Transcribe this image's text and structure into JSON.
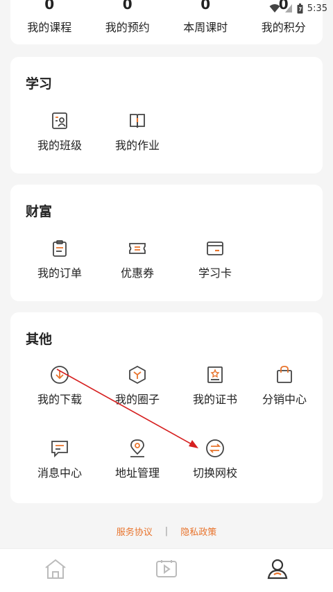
{
  "status_bar": {
    "time": "5:35",
    "icons": [
      "wifi-icon",
      "signal-icon",
      "battery-icon"
    ]
  },
  "stats": [
    {
      "value": "0",
      "label": "我的课程"
    },
    {
      "value": "0",
      "label": "我的预约"
    },
    {
      "value": "0",
      "label": "本周课时"
    },
    {
      "value": "0",
      "label": "我的积分"
    }
  ],
  "study": {
    "title": "学习",
    "items": [
      {
        "label": "我的班级",
        "icon": "class-icon"
      },
      {
        "label": "我的作业",
        "icon": "homework-icon"
      }
    ]
  },
  "wealth": {
    "title": "财富",
    "items": [
      {
        "label": "我的订单",
        "icon": "order-icon"
      },
      {
        "label": "优惠券",
        "icon": "coupon-icon"
      },
      {
        "label": "学习卡",
        "icon": "card-icon"
      }
    ]
  },
  "other": {
    "title": "其他",
    "items": [
      {
        "label": "我的下载",
        "icon": "download-icon"
      },
      {
        "label": "我的圈子",
        "icon": "circle-icon"
      },
      {
        "label": "我的证书",
        "icon": "certificate-icon"
      },
      {
        "label": "分销中心",
        "icon": "bag-icon"
      },
      {
        "label": "消息中心",
        "icon": "message-icon"
      },
      {
        "label": "地址管理",
        "icon": "location-icon"
      },
      {
        "label": "切换网校",
        "icon": "switch-icon"
      }
    ]
  },
  "footer": {
    "service_agreement": "服务协议",
    "separator": "|",
    "privacy_policy": "隐私政策"
  },
  "tabs": [
    {
      "icon": "home-icon",
      "active": false
    },
    {
      "icon": "video-icon",
      "active": false
    },
    {
      "icon": "profile-icon",
      "active": true
    }
  ],
  "colors": {
    "accent": "#e8742d",
    "icon_stroke": "#444444",
    "annotation": "#d62020"
  }
}
